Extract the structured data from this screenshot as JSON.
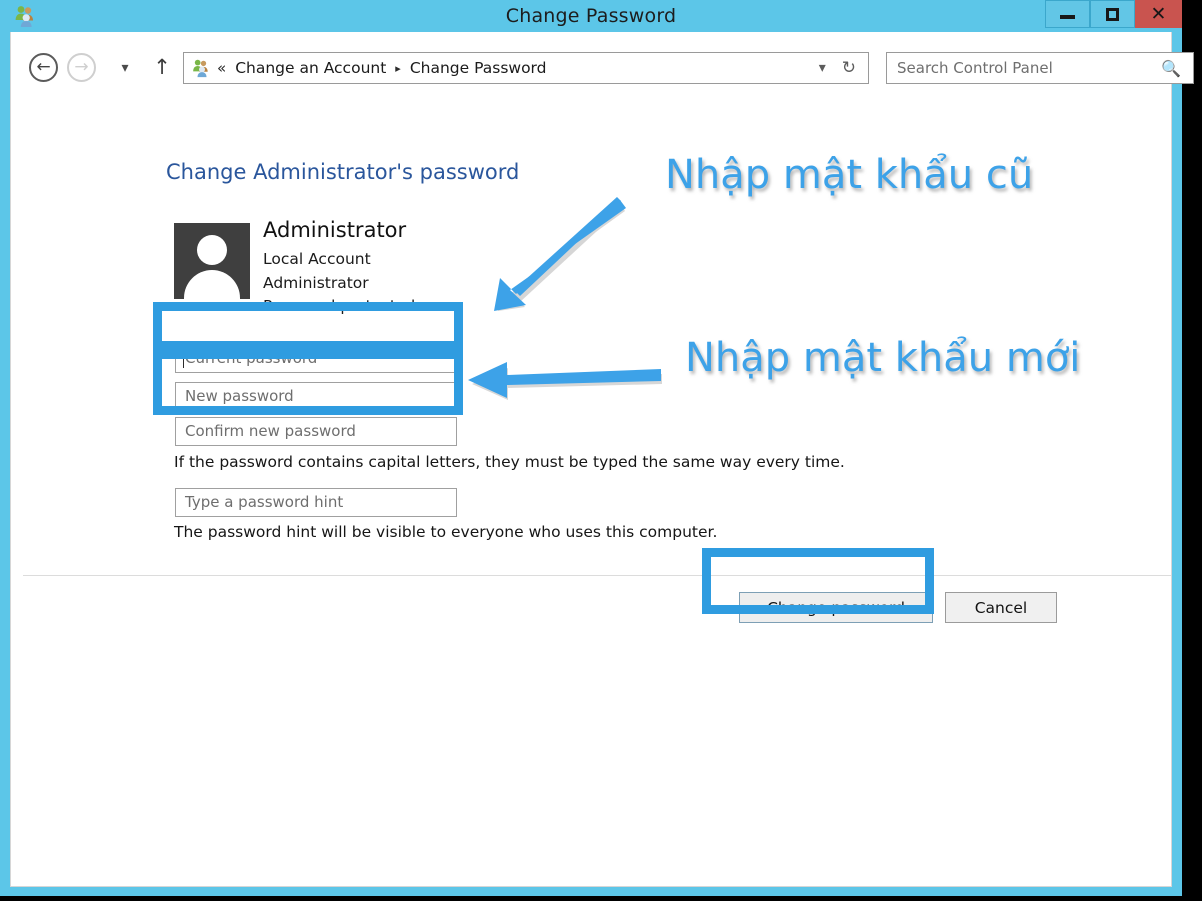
{
  "window": {
    "title": "Change Password",
    "app_icon": "users-icon",
    "controls": {
      "minimize": "minimize-icon",
      "maximize": "maximize-icon",
      "close": "close-icon"
    }
  },
  "navbar": {
    "back": "back-arrow-icon",
    "forward": "forward-arrow-icon",
    "history": "chevron-down-icon",
    "up": "up-arrow-icon",
    "address_icon": "users-icon",
    "address_prefix": "«",
    "breadcrumbs": [
      {
        "label": "Change an Account"
      },
      {
        "label": "Change Password"
      }
    ],
    "breadcrumb_separator": "▸",
    "dropdown": "chevron-down-icon",
    "refresh": "refresh-icon",
    "search": {
      "placeholder": "Search Control Panel",
      "value": "",
      "icon": "search-icon"
    }
  },
  "page": {
    "heading": "Change Administrator's password",
    "account": {
      "avatar": "user-avatar-icon",
      "name": "Administrator",
      "details": [
        "Local Account",
        "Administrator",
        "Password protected"
      ]
    },
    "fields": [
      {
        "name": "current-password",
        "placeholder": "Current password",
        "value": "",
        "focused": true
      },
      {
        "name": "new-password",
        "placeholder": "New password",
        "value": "",
        "focused": false
      },
      {
        "name": "confirm-new-password",
        "placeholder": "Confirm new password",
        "value": "",
        "focused": false
      }
    ],
    "caps_note": "If the password contains capital letters, they must be typed the same way every time.",
    "hint_field": {
      "placeholder": "Type a password hint",
      "value": ""
    },
    "hint_note": "The password hint will be visible to everyone who uses this computer.",
    "buttons": {
      "primary": "Change password",
      "secondary": "Cancel"
    }
  },
  "annotations": {
    "color": "#3da2e8",
    "texts": [
      {
        "name": "annotation-old-password",
        "text": "Nhập mật khẩu cũ"
      },
      {
        "name": "annotation-new-password",
        "text": "Nhập mật khẩu mới"
      }
    ],
    "arrows": [
      {
        "name": "annotation-arrow-old",
        "direction": "down-left"
      },
      {
        "name": "annotation-arrow-new",
        "direction": "left"
      }
    ],
    "boxes": [
      {
        "name": "annotation-box-current-password"
      },
      {
        "name": "annotation-box-new-password"
      },
      {
        "name": "annotation-box-change-password-button"
      }
    ]
  },
  "colors": {
    "titlebar": "#5cc6e8",
    "close_button": "#c9544f",
    "heading": "#2a569c",
    "annotation": "#3da2e8"
  }
}
